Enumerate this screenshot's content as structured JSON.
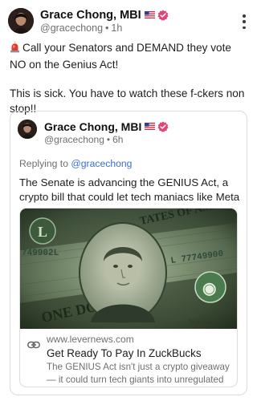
{
  "post": {
    "author_name": "Grace Chong, MBI",
    "handle": "@gracechong",
    "separator": "•",
    "time": "1h",
    "text_line_1": "Call your Senators and DEMAND they vote NO on the Genius Act!",
    "text_line_2": "This is sick. You have to watch these f-ckers non stop!!"
  },
  "quoted": {
    "author_name": "Grace Chong, MBI",
    "handle": "@gracechong",
    "separator": "•",
    "time": "6h",
    "replying_to_label": "Replying to",
    "replying_to_handle": "@gracechong",
    "text": "The Senate is advancing the GENIUS Act, a crypto bill that could let tech maniacs like Meta ...",
    "link": {
      "domain": "www.levernews.com",
      "title": "Get Ready To Pay In ZuckBucks",
      "description": "The GENIUS Act isn't just a crypto giveaway — it could turn tech giants into unregulated banks.",
      "image_icon": "dollar-bill-portrait-image"
    }
  },
  "icons": {
    "flag": "us-flag-icon",
    "verified": "verified-badge-icon",
    "more": "more-options-icon",
    "alarm": "siren-icon",
    "link": "link-icon"
  },
  "colors": {
    "verified": "#e0457b",
    "handle_link": "#3a6fd0",
    "siren": "#e23b2e"
  }
}
